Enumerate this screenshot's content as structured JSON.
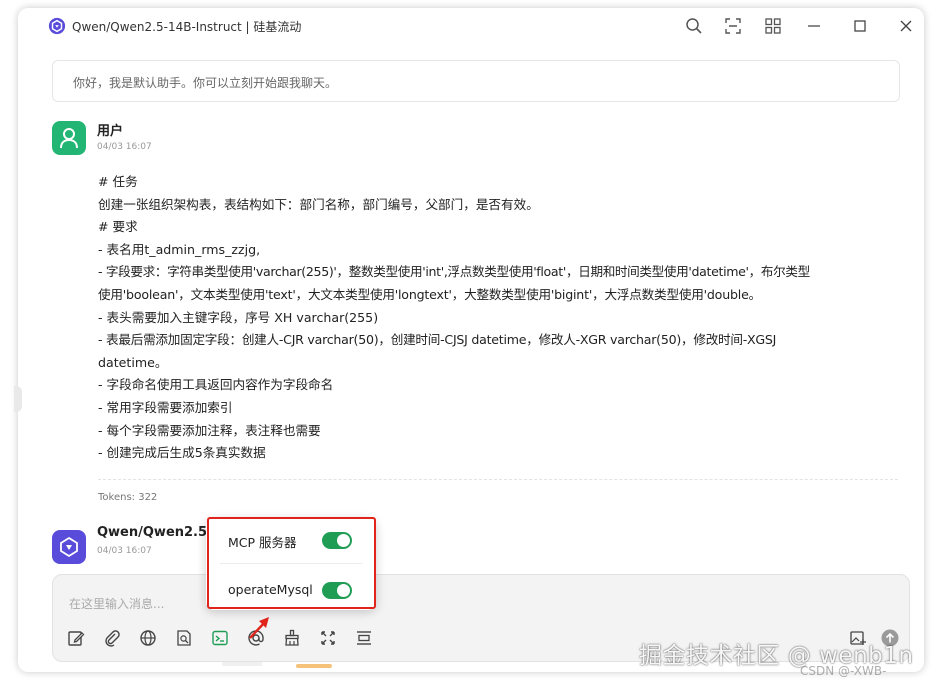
{
  "window": {
    "title": "Qwen/Qwen2.5-14B-Instruct | 硅基流动",
    "icons": [
      "search-icon",
      "expand-icon",
      "grid-icon",
      "minimize-icon",
      "maximize-icon",
      "close-icon"
    ]
  },
  "system_message": "你好，我是默认助手。你可以立刻开始跟我聊天。",
  "user_message": {
    "sender": "用户",
    "time": "04/03 16:07",
    "lines": [
      "# 任务",
      "   创建一张组织架构表，表结构如下：部门名称，部门编号，父部门，是否有效。",
      "# 要求",
      " - 表名用t_admin_rms_zzjg,",
      " - 字段要求：字符串类型使用'varchar(255)'，整数类型使用'int',浮点数类型使用'float'，日期和时间类型使用'datetime'，布尔类型",
      "使用'boolean'，文本类型使用'text'，大文本类型使用'longtext'，大整数类型使用'bigint'，大浮点数类型使用'double。",
      " - 表头需要加入主键字段，序号 XH varchar(255)",
      " - 表最后需添加固定字段：创建人-CJR varchar(50)，创建时间-CJSJ datetime，修改人-XGR varchar(50)，修改时间-XGSJ",
      "datetime。",
      " - 字段命名使用工具返回内容作为字段命名",
      " - 常用字段需要添加索引",
      " - 每个字段需要添加注释，表注释也需要",
      " - 创建完成后生成5条真实数据"
    ],
    "tokens": "Tokens: 322"
  },
  "assistant": {
    "sender": "Qwen/Qwen2.5-1",
    "time": "04/03 16:07"
  },
  "input": {
    "placeholder": "在这里输入消息..."
  },
  "popup": {
    "items": [
      {
        "label": "MCP 服务器",
        "enabled": true
      },
      {
        "label": "operateMysql",
        "enabled": true
      }
    ]
  },
  "toolbar_icons": [
    "edit-icon",
    "attach-icon",
    "globe-icon",
    "doc-search-icon",
    "terminal-icon",
    "at-icon",
    "broom-icon",
    "fullscreen-icon",
    "list-icon"
  ],
  "watermark": {
    "main": "掘金技术社区 @ wenb1n",
    "sub": "CSDN @-XWB-"
  },
  "colors": {
    "accent_green": "#1f9d55",
    "user_avatar": "#22b573",
    "bot_avatar": "#5a4cdb",
    "highlight_red": "#e0241b"
  }
}
